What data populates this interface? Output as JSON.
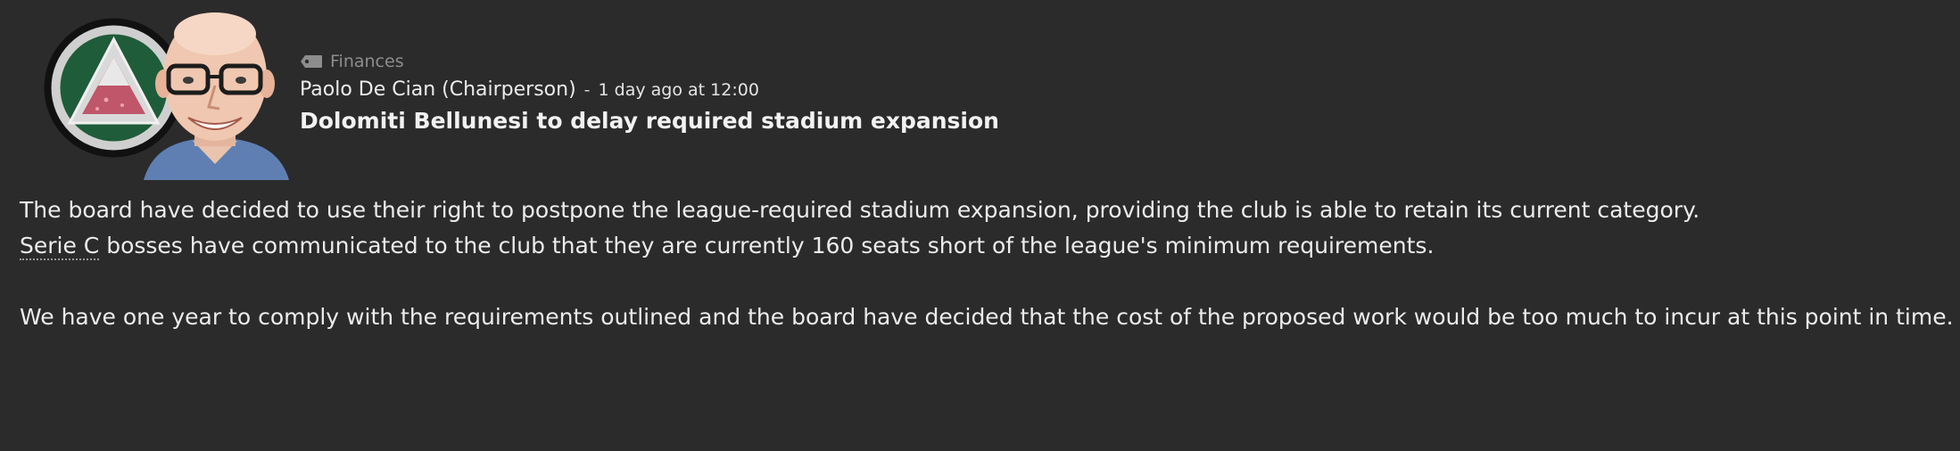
{
  "message": {
    "category": "Finances",
    "category_icon": "tag-icon",
    "sender": "Paolo De Cian (Chairperson)",
    "separator": "-",
    "timestamp": "1 day ago at 12:00",
    "headline": "Dolomiti Bellunesi to delay required stadium expansion",
    "body": {
      "para1_line1": "The board have decided to use their right to postpone the league-required stadium expansion, providing the club is able to retain its current category.",
      "league_link": "Serie C",
      "para1_line2_rest": " bosses have communicated to the club that they are currently 160 seats short of the league's minimum requirements.",
      "para2": "We have one year to comply with the requirements outlined and the board have decided that the cost of the proposed work would be too much to incur at this point in time."
    }
  },
  "colors": {
    "background": "#2b2b2b",
    "text": "#ececec",
    "muted": "#8d8d8d",
    "badge_green": "#1f5c3a",
    "badge_red": "#c0566a"
  }
}
